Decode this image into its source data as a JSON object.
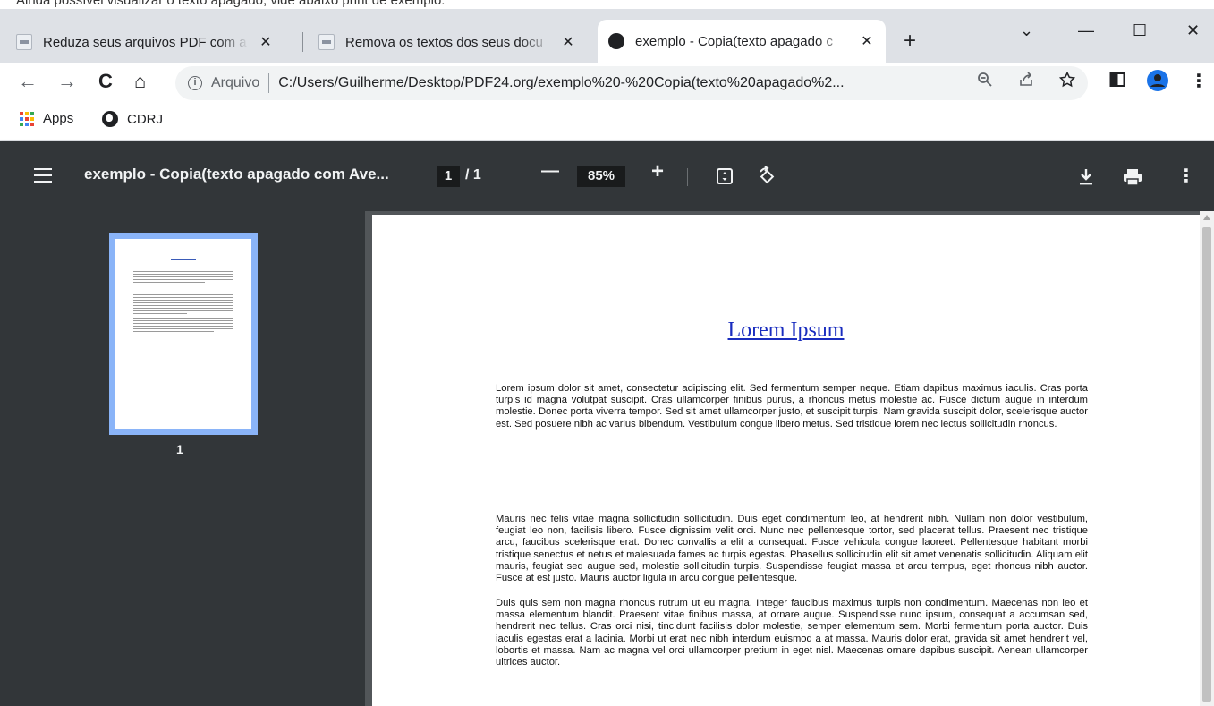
{
  "window": {
    "cut_text": "Ainda possível visualizar o texto apagado, vide abaixo print de exemplo:",
    "tabs": [
      {
        "title": "Reduza seus arquivos PDF com a",
        "active": false
      },
      {
        "title": "Remova os textos dos seus docu",
        "active": false
      },
      {
        "title": "exemplo - Copia(texto apagado c",
        "active": true
      }
    ],
    "new_tab": "+",
    "controls": {
      "collapse": "⌄",
      "minimize": "—",
      "maximize": "☐",
      "close": "✕"
    }
  },
  "toolbar": {
    "back": "←",
    "forward": "→",
    "reload": "C",
    "home": "⌂",
    "info_icon": "i",
    "scheme": "Arquivo",
    "url": "C:/Users/Guilherme/Desktop/PDF24.org/exemplo%20-%20Copia(texto%20apagado%2...",
    "zoom_icon": "zoom-out-icon",
    "share_icon": "share-icon",
    "bookmark_icon": "star-icon",
    "menu": "⋮"
  },
  "bookmarks": [
    {
      "label": "Apps",
      "icon": "apps-grid-icon"
    },
    {
      "label": "CDRJ",
      "icon": "globe-icon"
    }
  ],
  "pdf_toolbar": {
    "title": "exemplo - Copia(texto apagado com Ave...",
    "page_current": "1",
    "page_total": "/ 1",
    "zoom_out": "—",
    "zoom": "85%",
    "zoom_in": "+",
    "fit_icon": "fit-page-icon",
    "rotate_icon": "rotate-icon",
    "download_icon": "download-icon",
    "print_icon": "print-icon",
    "more": "⋮"
  },
  "sidebar": {
    "thumb_label": "1"
  },
  "document": {
    "title": "Lorem Ipsum",
    "paragraphs": [
      "Lorem ipsum dolor sit amet, consectetur adipiscing elit. Sed fermentum semper neque. Etiam dapibus maximus iaculis. Cras porta turpis id magna volutpat suscipit. Cras ullamcorper finibus purus, a rhoncus metus molestie ac. Fusce dictum augue in interdum molestie. Donec porta viverra tempor. Sed sit amet ullamcorper justo, et suscipit turpis. Nam gravida suscipit dolor, scelerisque auctor est. Sed posuere nibh ac varius bibendum. Vestibulum congue libero metus. Sed tristique lorem nec lectus sollicitudin rhoncus.",
      "Mauris nec felis vitae magna sollicitudin sollicitudin. Duis eget condimentum leo, at hendrerit nibh. Nullam non dolor vestibulum, feugiat leo non, facilisis libero. Fusce dignissim velit orci. Nunc nec pellentesque tortor, sed placerat tellus. Praesent nec tristique arcu, faucibus scelerisque erat. Donec convallis a elit a consequat. Fusce vehicula congue laoreet. Pellentesque habitant morbi tristique senectus et netus et malesuada fames ac turpis egestas. Phasellus sollicitudin elit sit amet venenatis sollicitudin. Aliquam elit mauris, feugiat sed augue sed, molestie sollicitudin turpis. Suspendisse feugiat massa et arcu tempus, eget rhoncus nibh auctor. Fusce at est justo. Mauris auctor ligula in arcu congue pellentesque.",
      "Duis quis sem non magna rhoncus rutrum ut eu magna. Integer faucibus maximus turpis non condimentum. Maecenas non leo et massa elementum blandit. Praesent vitae finibus massa, at ornare augue. Suspendisse nunc ipsum, consequat a accumsan sed, hendrerit nec tellus. Cras orci nisi, tincidunt facilisis dolor molestie, semper elementum sem. Morbi fermentum porta auctor. Duis iaculis egestas erat a lacinia. Morbi ut erat nec nibh interdum euismod a at massa. Mauris dolor erat, gravida sit amet hendrerit vel, lobortis et massa. Nam ac magna vel orci ullamcorper pretium in eget nisl. Maecenas ornare dapibus suscipit. Aenean ullamcorper ultrices auctor."
    ]
  }
}
